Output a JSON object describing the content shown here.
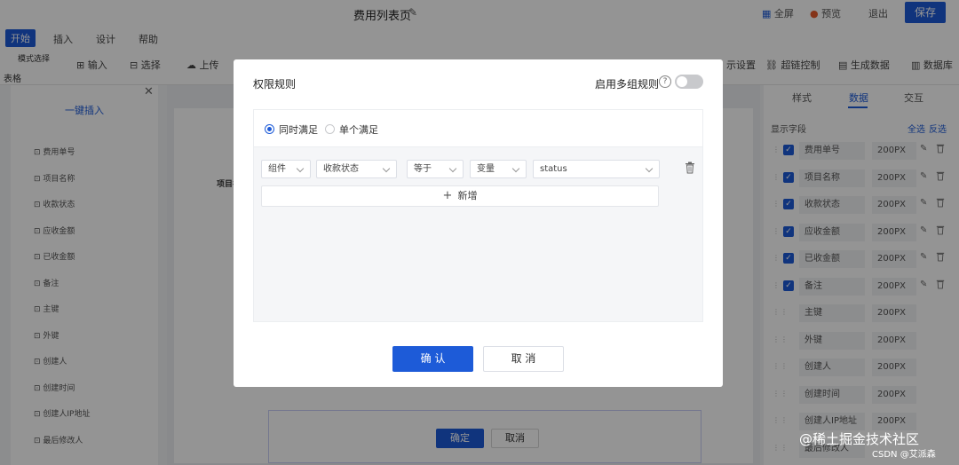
{
  "app": {
    "title": "费用列表页",
    "top_actions": [
      "全屏",
      "预览",
      "退出"
    ],
    "save_label": "保存"
  },
  "menu": {
    "items": [
      "开始",
      "插入",
      "设计",
      "帮助"
    ],
    "active_index": 0
  },
  "ribbon": {
    "mode_select": "模式选择",
    "table_label": "表格",
    "items": [
      "输入",
      "选择",
      "上传",
      "示设置",
      "超链控制",
      "生成数据",
      "数据库"
    ]
  },
  "left_panel": {
    "header": "一键插入",
    "items": [
      "费用单号",
      "项目名称",
      "收款状态",
      "应收金额",
      "已收金额",
      "备注",
      "主键",
      "外键",
      "创建人",
      "创建时间",
      "创建人IP地址",
      "最后修改人"
    ]
  },
  "canvas": {
    "column_label": "项目名",
    "sub_dialog": {
      "ok_label": "确定",
      "cancel_label": "取消"
    }
  },
  "right_panel": {
    "tabs": [
      "样式",
      "数据",
      "交互"
    ],
    "active_tab": 1,
    "section_label": "显示字段",
    "select_all": "全选",
    "invert": "反选",
    "fields": [
      {
        "name": "费用单号",
        "width": "200PX",
        "checked": true
      },
      {
        "name": "项目名称",
        "width": "200PX",
        "checked": true
      },
      {
        "name": "收款状态",
        "width": "200PX",
        "checked": true
      },
      {
        "name": "应收金额",
        "width": "200PX",
        "checked": true
      },
      {
        "name": "已收金额",
        "width": "200PX",
        "checked": true
      },
      {
        "name": "备注",
        "width": "200PX",
        "checked": true
      },
      {
        "name": "主键",
        "width": "200PX",
        "checked": false
      },
      {
        "name": "外键",
        "width": "200PX",
        "checked": false
      },
      {
        "name": "创建人",
        "width": "200PX",
        "checked": false
      },
      {
        "name": "创建时间",
        "width": "200PX",
        "checked": false
      },
      {
        "name": "创建人IP地址",
        "width": "200PX",
        "checked": false
      },
      {
        "name": "最后修改人",
        "width": "",
        "checked": false
      }
    ]
  },
  "modal": {
    "title": "权限规则",
    "multi_group_label": "启用多组规则",
    "multi_group_enabled": false,
    "match_options": [
      "同时满足",
      "单个满足"
    ],
    "match_selected": 0,
    "rule": {
      "type": "组件",
      "field": "收款状态",
      "operator": "等于",
      "value_type": "变量",
      "value": "status"
    },
    "add_label": "新增",
    "confirm_label": "确 认",
    "cancel_label": "取 消"
  },
  "watermark": {
    "main": "@稀土掘金技术社区",
    "sub": "CSDN @艾派森"
  },
  "colors": {
    "accent": "#1d5bd8",
    "overlay": "rgba(0,0,0,0.42)"
  }
}
